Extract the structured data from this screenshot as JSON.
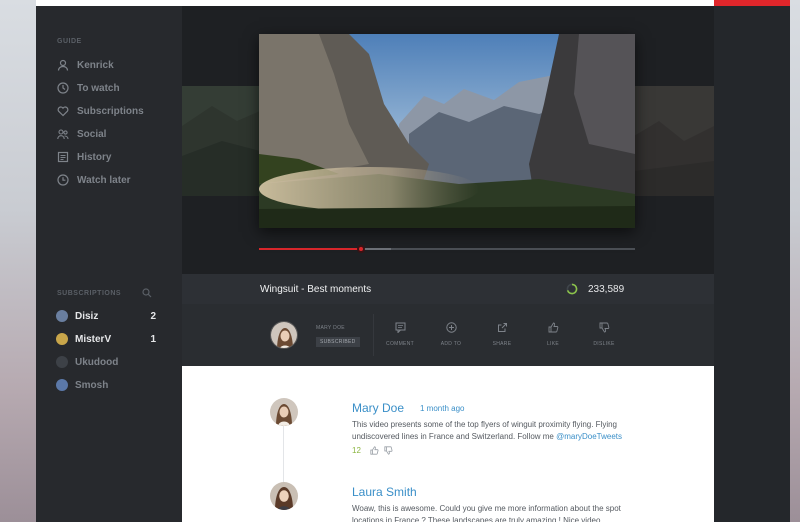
{
  "sidebar": {
    "guide_label": "GUIDE",
    "items": [
      {
        "label": "Kenrick",
        "icon": "user-icon"
      },
      {
        "label": "To watch",
        "icon": "clock-icon"
      },
      {
        "label": "Subscriptions",
        "icon": "heart-icon"
      },
      {
        "label": "Social",
        "icon": "people-icon"
      },
      {
        "label": "History",
        "icon": "history-icon"
      },
      {
        "label": "Watch later",
        "icon": "watch-later-icon"
      }
    ],
    "subscriptions_label": "SUBSCRIPTIONS",
    "subscriptions": [
      {
        "name": "Disiz",
        "count": "2",
        "color": "#6a7fa0"
      },
      {
        "name": "MisterV",
        "count": "1",
        "color": "#c9a64a"
      },
      {
        "name": "Ukudood",
        "count": "",
        "color": "#3d4147"
      },
      {
        "name": "Smosh",
        "count": "",
        "color": "#5b78a8"
      }
    ]
  },
  "video": {
    "title": "Wingsuit - Best moments",
    "views": "233,589",
    "progress_played": 0.27,
    "progress_buffered": 0.35
  },
  "author": {
    "name": "MARY DOE",
    "subscribe_label": "SUBSCRIBED"
  },
  "actions": [
    {
      "label": "COMMENT",
      "icon": "comment-icon"
    },
    {
      "label": "ADD TO",
      "icon": "add-icon"
    },
    {
      "label": "SHARE",
      "icon": "share-icon"
    },
    {
      "label": "LIKE",
      "icon": "thumbs-up-icon"
    },
    {
      "label": "DISLIKE",
      "icon": "thumbs-down-icon"
    }
  ],
  "comments": [
    {
      "name": "Mary Doe",
      "time": "1 month ago",
      "text": "This video presents some of the top flyers of winguit proximity flying. Flying undiscovered lines in France and Switzerland. Follow me ",
      "mention": "@maryDoeTweets",
      "likes": "12"
    },
    {
      "name": "Laura Smith",
      "text": "Woaw, this is awesome. Could you give me more information about the spot locations in France ? These landscapes are truly amazing ! Nice video."
    }
  ],
  "colors": {
    "accent": "#d8262b",
    "link": "#3a8fc8",
    "views_ring": "#8bc34a"
  }
}
